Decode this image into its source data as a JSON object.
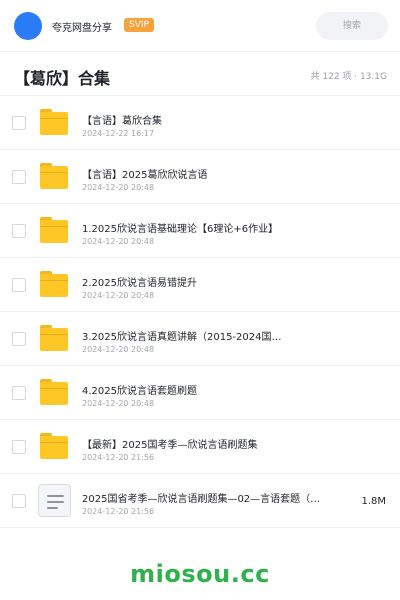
{
  "header": {
    "app_name": "夸克网盘分享",
    "badge": "SVIP",
    "search_placeholder": "搜索"
  },
  "title": "【葛欣】合集",
  "meta": "共 122 项 · 13.1G",
  "items": [
    {
      "type": "folder",
      "name": "【言语】葛欣合集",
      "date": "2024-12-22 16:17",
      "size": ""
    },
    {
      "type": "folder",
      "name": "【言语】2025葛欣欣说言语",
      "date": "2024-12-20 20:48",
      "size": ""
    },
    {
      "type": "folder",
      "name": "1.2025欣说言语基础理论【6理论+6作业】",
      "date": "2024-12-20 20:48",
      "size": ""
    },
    {
      "type": "folder",
      "name": "2.2025欣说言语易错提升",
      "date": "2024-12-20 20:48",
      "size": ""
    },
    {
      "type": "folder",
      "name": "3.2025欣说言语真题讲解（2015-2024国…",
      "date": "2024-12-20 20:48",
      "size": ""
    },
    {
      "type": "folder",
      "name": "4.2025欣说言语套题刷题",
      "date": "2024-12-20 20:48",
      "size": ""
    },
    {
      "type": "folder",
      "name": "【最新】2025国考季—欣说言语刷题集",
      "date": "2024-12-20 21:56",
      "size": ""
    },
    {
      "type": "file",
      "name": "2025国省考季—欣说言语刷题集—02—言语套题（…",
      "date": "2024-12-20 21:56",
      "size": "1.8M"
    }
  ],
  "watermark": "miosou.cc",
  "colors": {
    "accent": "#2a7cf6",
    "badge": "#f7a23b",
    "folder": "#ffc726",
    "watermark": "#2fb24b"
  }
}
